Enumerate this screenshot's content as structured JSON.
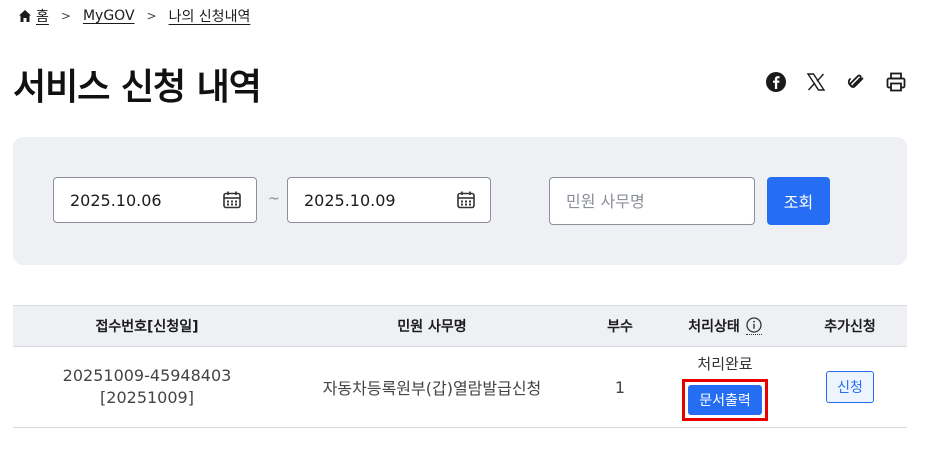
{
  "breadcrumb": {
    "home": "홈",
    "mygov": "MyGOV",
    "current": "나의 신청내역"
  },
  "page": {
    "title": "서비스 신청 내역"
  },
  "share": {
    "icons": [
      "facebook-icon",
      "x-icon",
      "link-icon",
      "print-icon"
    ]
  },
  "search": {
    "start_date": "2025.10.06",
    "end_date": "2025.10.09",
    "separator": "~",
    "service_placeholder": "민원 사무명",
    "search_label": "조회"
  },
  "table": {
    "headers": {
      "receipt": "접수번호[신청일]",
      "service": "민원 사무명",
      "copies": "부수",
      "status": "처리상태",
      "additional": "추가신청"
    },
    "rows": [
      {
        "receipt_no": "20251009-45948403",
        "date": "[20251009]",
        "service": "자동차등록원부(갑)열람발급신청",
        "copies": "1",
        "status": "처리완료",
        "print_label": "문서출력",
        "apply_label": "신청"
      }
    ]
  },
  "colors": {
    "accent": "#256ef4",
    "highlight": "#e60000",
    "panel": "#eef0f4"
  }
}
